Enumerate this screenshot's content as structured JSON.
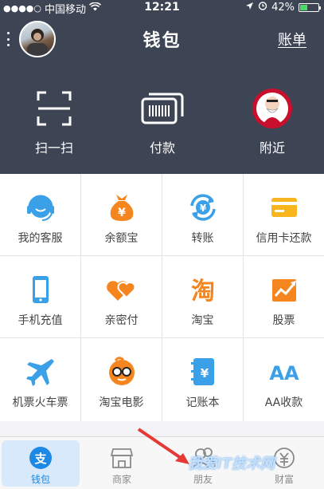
{
  "status_bar": {
    "carrier": "中国移动",
    "time": "12:21",
    "battery": "42%",
    "battery_level": 0.42
  },
  "header": {
    "title": "钱包",
    "right_link": "账单"
  },
  "quick_actions": [
    {
      "label": "扫一扫",
      "icon": "scan-icon"
    },
    {
      "label": "付款",
      "icon": "barcode-card-icon"
    },
    {
      "label": "附近",
      "icon": "kfc-logo-icon"
    }
  ],
  "services": [
    {
      "label": "我的客服",
      "icon": "customer-service-icon",
      "color": "#3aa0e8"
    },
    {
      "label": "余额宝",
      "icon": "yuebao-bag-icon",
      "color": "#f5861f"
    },
    {
      "label": "转账",
      "icon": "transfer-icon",
      "color": "#3aa0e8"
    },
    {
      "label": "信用卡还款",
      "icon": "credit-card-icon",
      "color": "#f8b51d"
    },
    {
      "label": "手机充值",
      "icon": "phone-recharge-icon",
      "color": "#3aa0e8"
    },
    {
      "label": "亲密付",
      "icon": "hearts-icon",
      "color": "#f5861f"
    },
    {
      "label": "淘宝",
      "icon": "taobao-icon",
      "color": "#f5861f"
    },
    {
      "label": "股票",
      "icon": "stocks-icon",
      "color": "#f5861f"
    },
    {
      "label": "机票火车票",
      "icon": "airplane-icon",
      "color": "#3aa0e8"
    },
    {
      "label": "淘宝电影",
      "icon": "movie-glasses-icon",
      "color": "#f5861f"
    },
    {
      "label": "记账本",
      "icon": "account-book-icon",
      "color": "#3aa0e8"
    },
    {
      "label": "AA收款",
      "icon": "aa-icon",
      "color": "#3aa0e8"
    }
  ],
  "tabs": [
    {
      "label": "钱包",
      "icon": "alipay-icon",
      "active": true
    },
    {
      "label": "商家",
      "icon": "store-icon",
      "active": false
    },
    {
      "label": "朋友",
      "icon": "friends-icon",
      "active": false
    },
    {
      "label": "财富",
      "icon": "wealth-icon",
      "active": false
    }
  ],
  "watermark": "我爱IT技术网",
  "colors": {
    "header_bg": "#3d4454",
    "accent_blue": "#3aa0e8",
    "accent_orange": "#f5861f"
  }
}
